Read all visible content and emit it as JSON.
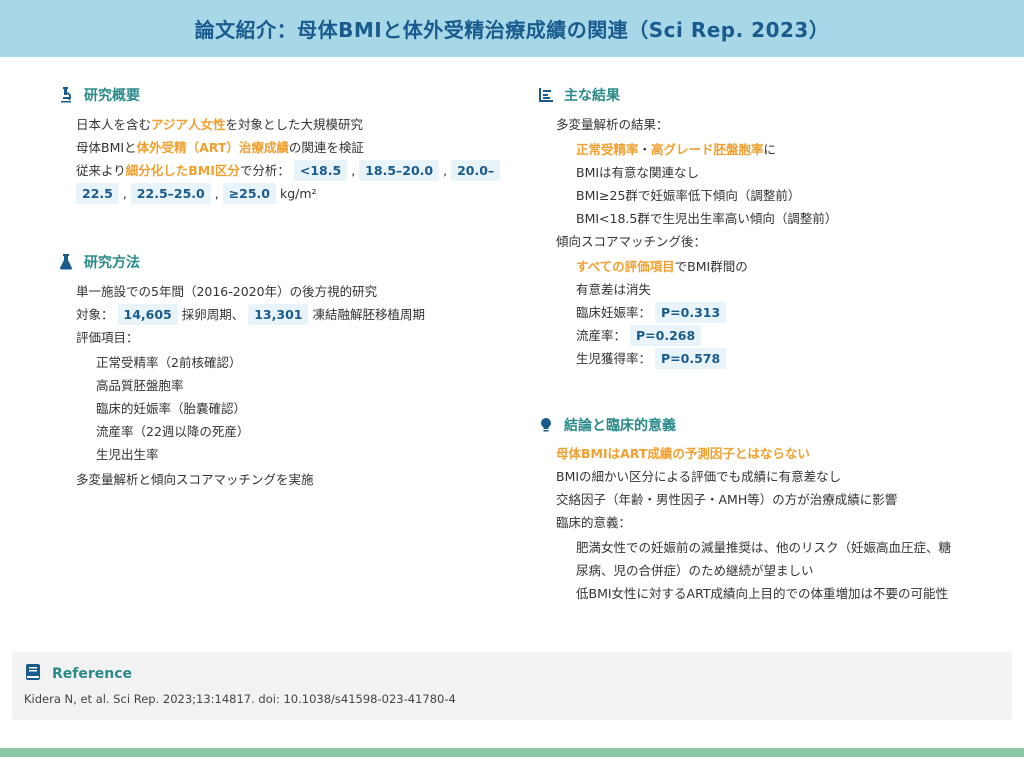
{
  "title": "論文紹介：母体BMIと体外受精治療成績の関連（Sci Rep. 2023）",
  "overview": {
    "heading": "研究概要",
    "l1_a": "日本人を含む",
    "l1_hl": "アジア人女性",
    "l1_b": "を対象とした大規模研究",
    "l2_a": "母体BMIと",
    "l2_hl": "体外受精（ART）治療成績",
    "l2_b": "の関連を検証",
    "l3_a": "従来より",
    "l3_hl": "細分化したBMI区分",
    "l3_b": "で分析：",
    "cat1": "<18.5",
    "cat2": "18.5–20.0",
    "cat3a": "20.0–",
    "cat3b": "22.5",
    "cat4": "22.5–25.0",
    "cat5": "≥25.0",
    "unit": "kg/m²",
    "comma": ","
  },
  "methods": {
    "heading": "研究方法",
    "l1": "単一施設での5年間（2016-2020年）の後方視的研究",
    "l2_a": "対象：",
    "n1": "14,605",
    "l2_b": "採卵周期、",
    "n2": "13,301",
    "l2_c": "凍結融解胚移植周期",
    "l3": "評価項目：",
    "items": [
      "正常受精率（2前核確認）",
      "高品質胚盤胞率",
      "臨床的妊娠率（胎嚢確認）",
      "流産率（22週以降の死産）",
      "生児出生率"
    ],
    "l4": "多変量解析と傾向スコアマッチングを実施"
  },
  "results": {
    "heading": "主な結果",
    "l1": "多変量解析の結果：",
    "l2_hl1": "正常受精率",
    "l2_sep": "・",
    "l2_hl2": "高グレード胚盤胞率",
    "l2_b": "に",
    "l3": "BMIは有意な関連なし",
    "l4": "BMI≥25群で妊娠率低下傾向（調整前）",
    "l5": "BMI<18.5群で生児出生率高い傾向（調整前）",
    "l6": "傾向スコアマッチング後：",
    "l7_hl": "すべての評価項目",
    "l7_b": "でBMI群間の",
    "l8": "有意差は消失",
    "p1_label": "臨床妊娠率：",
    "p1": "P=0.313",
    "p2_label": "流産率：",
    "p2": "P=0.268",
    "p3_label": "生児獲得率：",
    "p3": "P=0.578"
  },
  "conclusion": {
    "heading": "結論と臨床的意義",
    "l1": "母体BMIはART成績の予測因子とはならない",
    "l2": "BMIの細かい区分による評価でも成績に有意差なし",
    "l3": "交絡因子（年齢・男性因子・AMH等）の方が治療成績に影響",
    "l4": "臨床的意義：",
    "l5a": "肥満女性での妊娠前の減量推奨は、他のリスク（妊娠高血圧症、糖",
    "l5b": "尿病、児の合併症）のため継続が望ましい",
    "l6": "低BMI女性に対するART成績向上目的での体重増加は不要の可能性"
  },
  "reference": {
    "heading": "Reference",
    "text": "Kidera N, et al. Sci Rep. 2023;13:14817. doi: 10.1038/s41598-023-41780-4"
  },
  "colors": {
    "title_bg": "#a8d8e8",
    "title_text": "#1a5b8e",
    "heading": "#2a8a8a",
    "highlight": "#f0a030",
    "chip_bg": "#e9f3fa",
    "bottom_bar": "#8cc8a4"
  },
  "icons": {
    "overview": "microscope-icon",
    "methods": "flask-icon",
    "results": "bar-list-icon",
    "conclusion": "lightbulb-icon",
    "reference": "book-icon"
  }
}
